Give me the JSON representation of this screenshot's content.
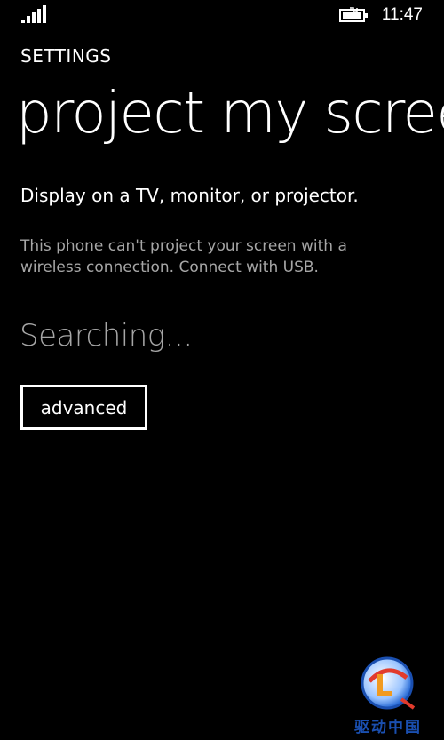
{
  "status_bar": {
    "time": "11:47",
    "icons": [
      "signal-icon",
      "battery-charging-icon"
    ]
  },
  "header": {
    "app_label": "SETTINGS",
    "page_title": "project my screen"
  },
  "main": {
    "description": "Display on a TV, monitor, or projector.",
    "note": "This phone can't project your screen with a wireless connection. Connect with USB.",
    "status": "Searching...",
    "advanced_label": "advanced"
  },
  "watermark": {
    "text": "驱动中国"
  },
  "colors": {
    "background": "#000000",
    "foreground": "#ffffff",
    "secondary_text": "#a6a6a6"
  }
}
